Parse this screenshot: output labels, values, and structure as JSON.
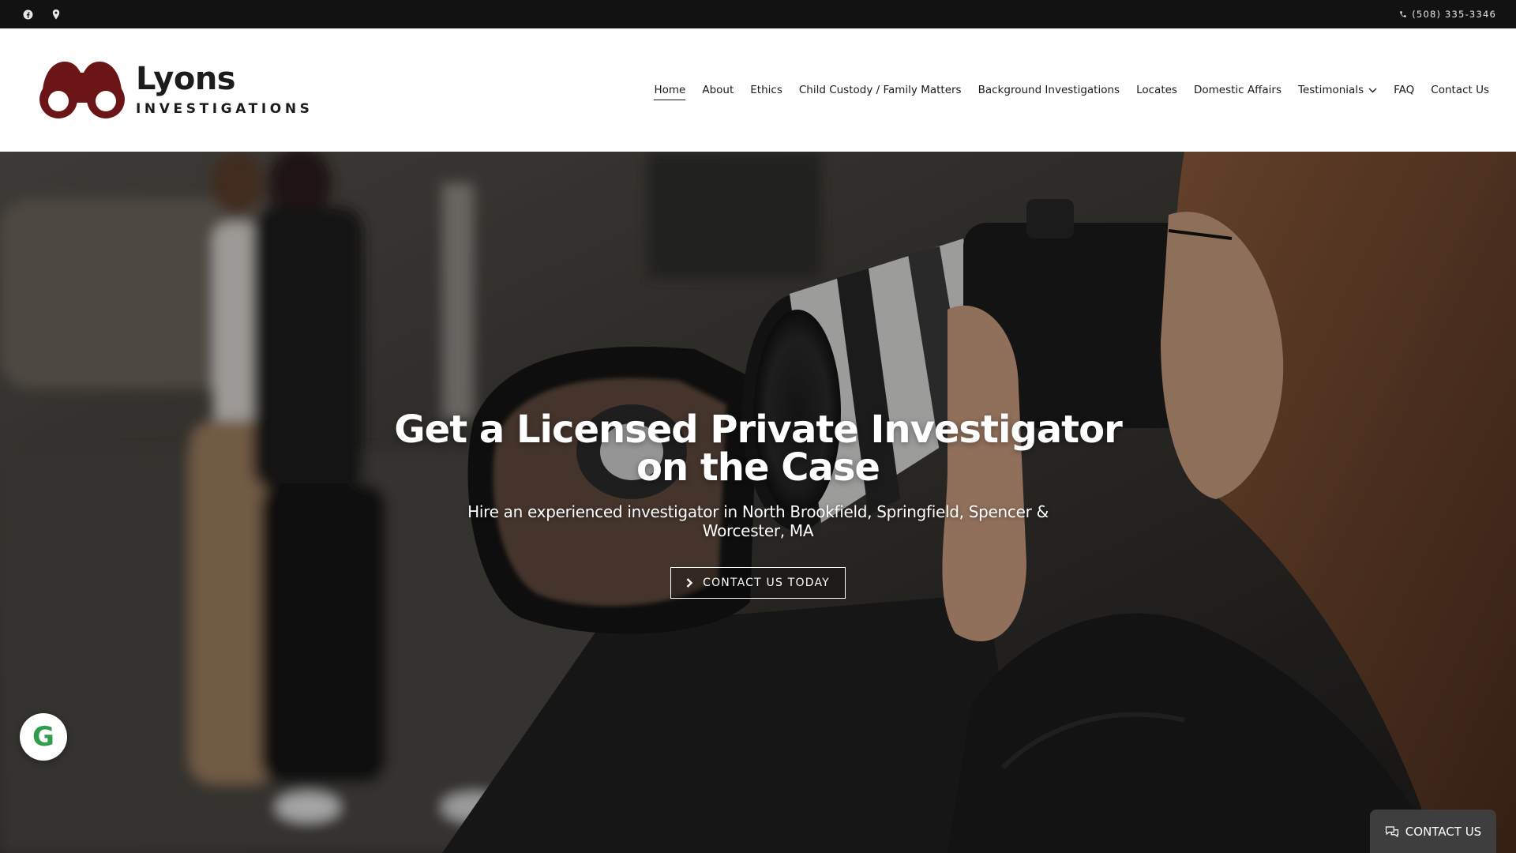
{
  "topbar": {
    "phone": "(508) 335-3346",
    "social_icons": [
      "facebook-icon",
      "map-pin-icon"
    ]
  },
  "header": {
    "logo": {
      "name": "Lyons",
      "tagline": "INVESTIGATIONS",
      "color": "#6b1517"
    },
    "nav": [
      {
        "label": "Home",
        "active": true
      },
      {
        "label": "About"
      },
      {
        "label": "Ethics"
      },
      {
        "label": "Child Custody / Family Matters"
      },
      {
        "label": "Background Investigations"
      },
      {
        "label": "Locates"
      },
      {
        "label": "Domestic Affairs"
      },
      {
        "label": "Testimonials",
        "has_dropdown": true
      },
      {
        "label": "FAQ"
      },
      {
        "label": "Contact Us"
      }
    ]
  },
  "hero": {
    "title_line1": "Get a Licensed Private Investigator",
    "title_line2": "on the Case",
    "subtitle_line1": "Hire an experienced investigator in North Brookfield, Springfield, Spencer &",
    "subtitle_line2": "Worcester, MA",
    "cta_label": "CONTACT US TODAY"
  },
  "widgets": {
    "google_badge_letter": "G",
    "floating_contact_label": "CONTACT US"
  },
  "colors": {
    "topbar_bg": "#121212",
    "logo_red": "#6b1517",
    "google_green": "#2f9d4c",
    "floating_button_bg": "#3e3e3e"
  }
}
